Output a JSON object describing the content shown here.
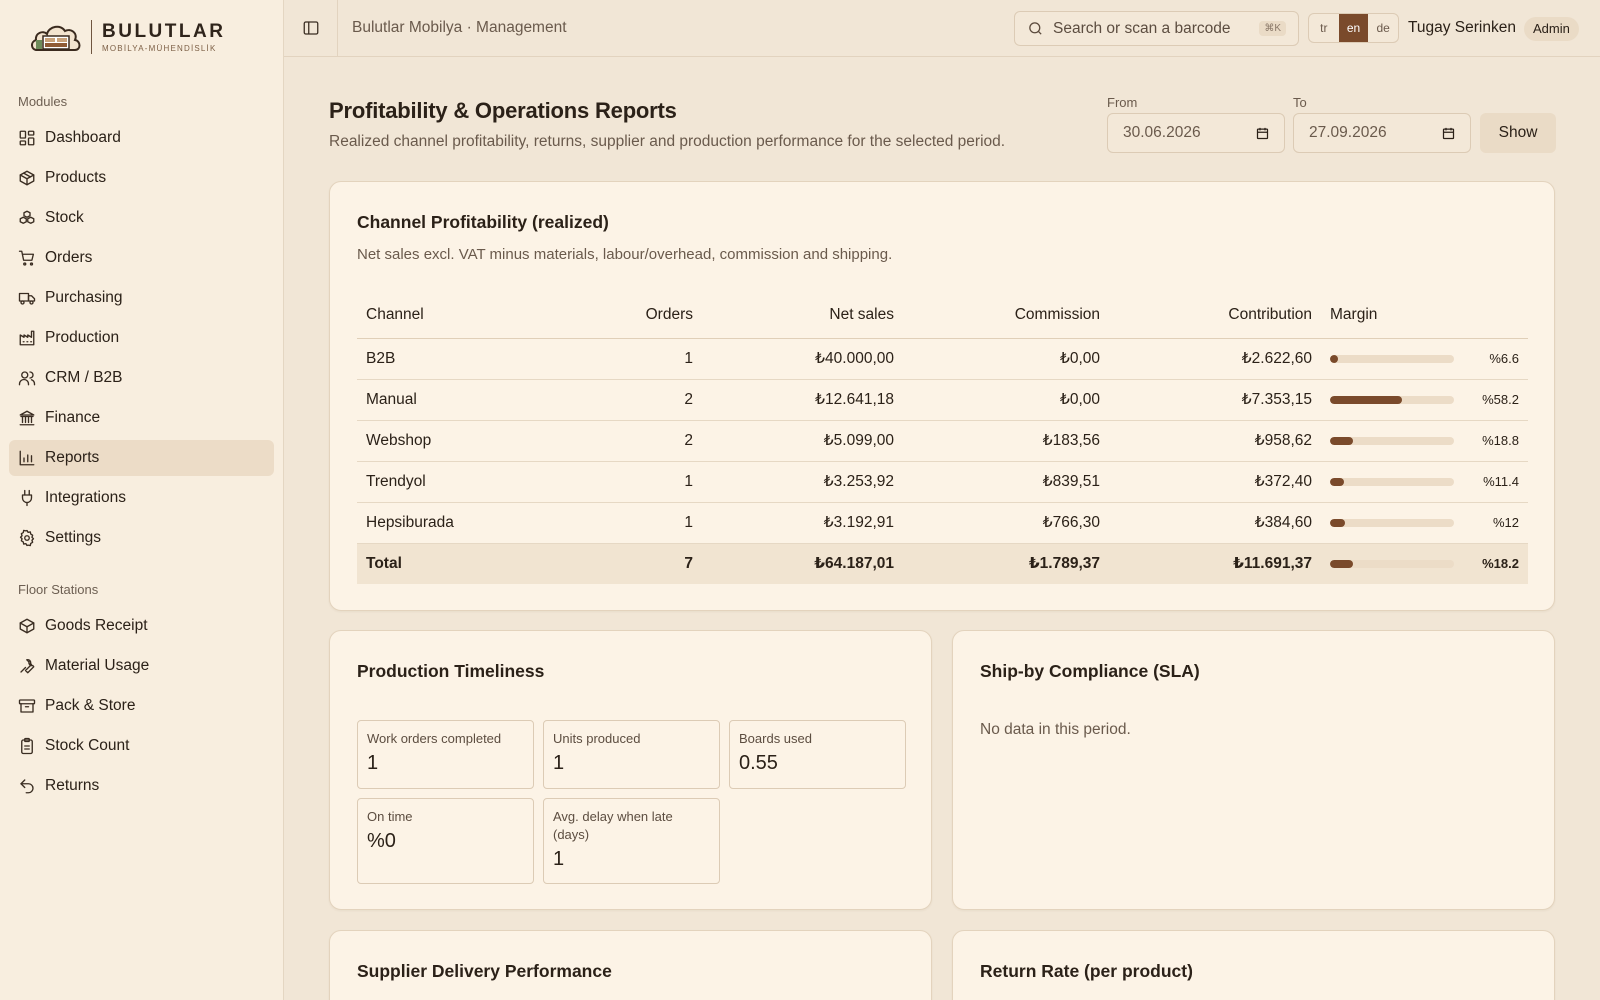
{
  "brand": {
    "name": "BULUTLAR",
    "tagline": "MOBİLYA-MÜHENDİSLİK"
  },
  "sidebar": {
    "modules_title": "Modules",
    "modules": [
      {
        "label": "Dashboard",
        "icon": "dashboard-icon"
      },
      {
        "label": "Products",
        "icon": "box-icon"
      },
      {
        "label": "Stock",
        "icon": "boxes-icon"
      },
      {
        "label": "Orders",
        "icon": "cart-icon"
      },
      {
        "label": "Purchasing",
        "icon": "truck-icon"
      },
      {
        "label": "Production",
        "icon": "factory-icon"
      },
      {
        "label": "CRM / B2B",
        "icon": "users-icon"
      },
      {
        "label": "Finance",
        "icon": "bank-icon"
      },
      {
        "label": "Reports",
        "icon": "bar-chart-icon",
        "active": true
      },
      {
        "label": "Integrations",
        "icon": "plug-icon"
      },
      {
        "label": "Settings",
        "icon": "gear-icon"
      }
    ],
    "floor_title": "Floor Stations",
    "floor": [
      {
        "label": "Goods Receipt",
        "icon": "package-icon"
      },
      {
        "label": "Material Usage",
        "icon": "wrench-icon"
      },
      {
        "label": "Pack & Store",
        "icon": "archive-icon"
      },
      {
        "label": "Stock Count",
        "icon": "clipboard-icon"
      },
      {
        "label": "Returns",
        "icon": "undo-icon"
      }
    ]
  },
  "topbar": {
    "title": "Bulutlar Mobilya · Management",
    "search_placeholder": "Search or scan a barcode",
    "search_shortcut": "⌘K",
    "languages": [
      "tr",
      "en",
      "de"
    ],
    "active_language": "en",
    "user_name": "Tugay Serinken",
    "user_role": "Admin"
  },
  "header": {
    "title": "Profitability & Operations Reports",
    "subtitle": "Realized channel profitability, returns, supplier and production performance for the selected period.",
    "from_label": "From",
    "from_value": "30.06.2026",
    "to_label": "To",
    "to_value": "27.09.2026",
    "show_label": "Show"
  },
  "channel_profitability": {
    "title": "Channel Profitability (realized)",
    "description": "Net sales excl. VAT minus materials, labour/overhead, commission and shipping.",
    "columns": [
      "Channel",
      "Orders",
      "Net sales",
      "Commission",
      "Contribution",
      "Margin"
    ],
    "rows": [
      {
        "channel": "B2B",
        "orders": "1",
        "net_sales": "₺40.000,00",
        "commission": "₺0,00",
        "contribution": "₺2.622,60",
        "margin_label": "%6.6",
        "margin": 6.6
      },
      {
        "channel": "Manual",
        "orders": "2",
        "net_sales": "₺12.641,18",
        "commission": "₺0,00",
        "contribution": "₺7.353,15",
        "margin_label": "%58.2",
        "margin": 58.2
      },
      {
        "channel": "Webshop",
        "orders": "2",
        "net_sales": "₺5.099,00",
        "commission": "₺183,56",
        "contribution": "₺958,62",
        "margin_label": "%18.8",
        "margin": 18.8
      },
      {
        "channel": "Trendyol",
        "orders": "1",
        "net_sales": "₺3.253,92",
        "commission": "₺839,51",
        "contribution": "₺372,40",
        "margin_label": "%11.4",
        "margin": 11.4
      },
      {
        "channel": "Hepsiburada",
        "orders": "1",
        "net_sales": "₺3.192,91",
        "commission": "₺766,30",
        "contribution": "₺384,60",
        "margin_label": "%12",
        "margin": 12
      }
    ],
    "total": {
      "channel": "Total",
      "orders": "7",
      "net_sales": "₺64.187,01",
      "commission": "₺1.789,37",
      "contribution": "₺11.691,37",
      "margin_label": "%18.2",
      "margin": 18.2
    }
  },
  "production_timeliness": {
    "title": "Production Timeliness",
    "stats": [
      {
        "label": "Work orders completed",
        "value": "1"
      },
      {
        "label": "Units produced",
        "value": "1"
      },
      {
        "label": "Boards used",
        "value": "0.55"
      },
      {
        "label": "On time",
        "value": "%0"
      },
      {
        "label": "Avg. delay when late (days)",
        "value": "1"
      }
    ]
  },
  "sla": {
    "title": "Ship-by Compliance (SLA)",
    "empty_text": "No data in this period."
  },
  "supplier_delivery": {
    "title": "Supplier Delivery Performance"
  },
  "return_rate": {
    "title": "Return Rate (per product)"
  },
  "colors": {
    "accent": "#7a4a2b",
    "background": "#f1e6d6",
    "card": "#fcf3e6",
    "sidebar": "#f8eedf"
  }
}
